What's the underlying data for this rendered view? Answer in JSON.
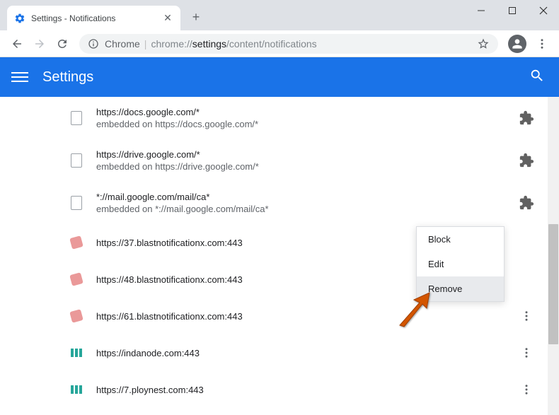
{
  "window": {
    "tab_title": "Settings - Notifications"
  },
  "toolbar": {
    "chrome_label": "Chrome",
    "url_prefix": "chrome://",
    "url_bold": "settings",
    "url_rest": "/content/notifications"
  },
  "header": {
    "title": "Settings"
  },
  "sites": [
    {
      "url": "https://docs.google.com/*",
      "sub": "embedded on https://docs.google.com/*",
      "icon": "doc",
      "action": "puzzle"
    },
    {
      "url": "https://drive.google.com/*",
      "sub": "embedded on https://drive.google.com/*",
      "icon": "doc",
      "action": "puzzle"
    },
    {
      "url": "*://mail.google.com/mail/ca*",
      "sub": "embedded on *://mail.google.com/mail/ca*",
      "icon": "doc",
      "action": "puzzle"
    },
    {
      "url": "https://37.blastnotificationx.com:443",
      "sub": "",
      "icon": "speaker",
      "action": "hidden"
    },
    {
      "url": "https://48.blastnotificationx.com:443",
      "sub": "",
      "icon": "speaker",
      "action": "hidden"
    },
    {
      "url": "https://61.blastnotificationx.com:443",
      "sub": "",
      "icon": "speaker",
      "action": "dots"
    },
    {
      "url": "https://indanode.com:443",
      "sub": "",
      "icon": "green",
      "action": "dots"
    },
    {
      "url": "https://7.ploynest.com:443",
      "sub": "",
      "icon": "green",
      "action": "dots"
    }
  ],
  "menu": {
    "block": "Block",
    "edit": "Edit",
    "remove": "Remove"
  }
}
